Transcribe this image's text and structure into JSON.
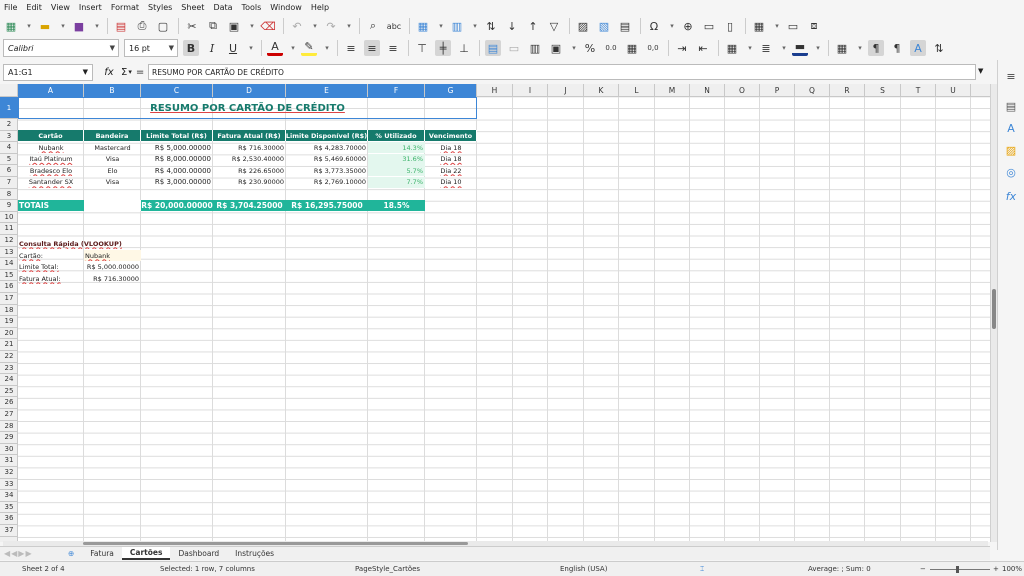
{
  "menu": [
    "File",
    "Edit",
    "View",
    "Insert",
    "Format",
    "Styles",
    "Sheet",
    "Data",
    "Tools",
    "Window",
    "Help"
  ],
  "toolbar": {
    "font_name": "Calibri",
    "font_size": "16 pt",
    "bold_label": "B",
    "italic_label": "I",
    "underline_label": "U",
    "percent_label": "%",
    "decimal_label": "0.0",
    "number_label": "0,0"
  },
  "formula_bar": {
    "cell_ref": "A1:G1",
    "fx_symbol": "fx",
    "sigma_symbol": "Σ",
    "equals_symbol": "=",
    "content": "RESUMO POR CARTÃO DE CRÉDITO"
  },
  "columns": [
    "A",
    "B",
    "C",
    "D",
    "E",
    "F",
    "G",
    "H",
    "I",
    "J",
    "K",
    "L",
    "M",
    "N",
    "O",
    "P",
    "Q",
    "R",
    "S",
    "T",
    "U"
  ],
  "rows": [
    "1",
    "2",
    "3",
    "4",
    "5",
    "6",
    "7",
    "8",
    "9",
    "10",
    "11",
    "12",
    "13",
    "14",
    "15",
    "16",
    "17",
    "18",
    "19",
    "20",
    "21",
    "22",
    "23",
    "24",
    "25",
    "26",
    "27",
    "28",
    "29",
    "30",
    "31",
    "32",
    "33",
    "34",
    "35",
    "36",
    "37"
  ],
  "sheet": {
    "title": "RESUMO POR CARTÃO DE CRÉDITO",
    "headers": [
      "Cartão",
      "Bandeira",
      "Limite Total (R$)",
      "Fatura Atual (R$)",
      "Limite Disponível (R$)",
      "% Utilizado",
      "Vencimento"
    ],
    "table_rows": [
      {
        "cartao": "Nubank",
        "bandeira": "Mastercard",
        "limite": "R$ 5,000.00000",
        "fatura": "R$ 716.30000",
        "disponivel": "R$ 4,283.70000",
        "pct": "14.3%",
        "venc": "Dia 18"
      },
      {
        "cartao": "Itaú Platinum",
        "bandeira": "Visa",
        "limite": "R$ 8,000.00000",
        "fatura": "R$ 2,530.40000",
        "disponivel": "R$ 5,469.60000",
        "pct": "31.6%",
        "venc": "Dia 18"
      },
      {
        "cartao": "Bradesco Elo",
        "bandeira": "Elo",
        "limite": "R$ 4,000.00000",
        "fatura": "R$ 226.65000",
        "disponivel": "R$ 3,773.35000",
        "pct": "5.7%",
        "venc": "Dia 22"
      },
      {
        "cartao": "Santander SX",
        "bandeira": "Visa",
        "limite": "R$ 3,000.00000",
        "fatura": "R$ 230.90000",
        "disponivel": "R$ 2,769.10000",
        "pct": "7.7%",
        "venc": "Dia 10"
      }
    ],
    "totals": {
      "label": "TOTAIS",
      "limite": "R$ 20,000.00000",
      "fatura": "R$ 3,704.25000",
      "disponivel": "R$ 16,295.75000",
      "pct": "18.5%"
    },
    "lookup": {
      "heading": "Consulta Rápida (VLOOKUP)",
      "card_label": "Cartão:",
      "card_value": "Nubank",
      "limit_label": "Limite Total:",
      "limit_value": "R$ 5,000.00000",
      "invoice_label": "Fatura Atual:",
      "invoice_value": "R$ 716.30000"
    }
  },
  "tabs": [
    "Fatura",
    "Cartões",
    "Dashboard",
    "Instruções"
  ],
  "active_tab": "Cartões",
  "statusbar": {
    "sheet": "Sheet 2 of 4",
    "selection": "Selected: 1 row, 7 columns",
    "page_style": "PageStyle_Cartões",
    "language": "English (USA)",
    "summary": "Average: ; Sum: 0",
    "zoom": "100%"
  },
  "colors": {
    "header": "#167a6c",
    "totals": "#20b59a",
    "pct_text": "#3bb36a",
    "selection": "#3d86d6"
  }
}
